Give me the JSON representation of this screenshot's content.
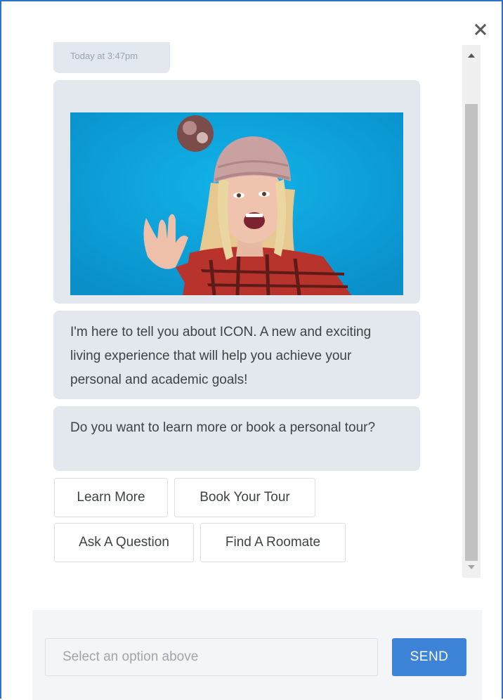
{
  "widget": {
    "close_icon": "close-icon"
  },
  "chat": {
    "timestamp": "Today at 3:47pm",
    "image": {
      "kind": "animated-gif",
      "background_color": "#0da3dc"
    },
    "messages": [
      "I'm here to tell you about ICON. A new and exciting living experience that will help you achieve your personal and academic goals!",
      "Do you want to learn more or book a personal tour?"
    ],
    "options": [
      "Learn More",
      "Book Your Tour",
      "Ask A Question",
      "Find A Roomate"
    ]
  },
  "scrollbar": {
    "up_icon": "triangle-up-icon",
    "down_icon": "triangle-down-icon"
  },
  "composer": {
    "input_value": "",
    "input_placeholder": "Select an option above",
    "send_label": "SEND"
  },
  "colors": {
    "frame_border": "#2d72c4",
    "bubble_bg": "#e2e8ee",
    "send_button": "#3d84d9"
  }
}
